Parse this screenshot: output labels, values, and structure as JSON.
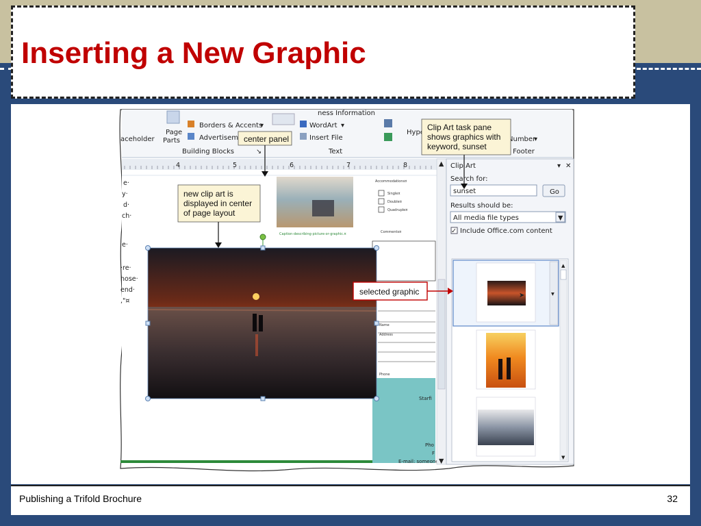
{
  "slide": {
    "title": "Inserting a New Graphic",
    "footer_left": "Publishing a Trifold Brochure",
    "page_number": "32"
  },
  "ribbon": {
    "placeholder_label": "aceholder",
    "page_parts_label": "Page",
    "page_parts_label2": "Parts",
    "borders_accents": "Borders & Accents",
    "advertisements": "Advertiseme",
    "building_blocks": "Building Blocks",
    "business_information": "ness Information",
    "wordart": "WordArt",
    "insert_file": "Insert File",
    "text_group": "Text",
    "hyperlink_partial": "Hype",
    "number_label": "Number",
    "header_footer_partial": "t Footer"
  },
  "ruler": {
    "marks": [
      "4",
      "5",
      "6",
      "7",
      "8"
    ]
  },
  "document": {
    "left_fragments": [
      "e·",
      "y·",
      "d·",
      "ch·",
      "e·",
      "·re·",
      "hose·",
      "end·",
      ",\"¤"
    ],
    "caption": "Caption·describing·picture·or·graphic.¤",
    "form_heading": "Accommodations¤",
    "options": [
      "Single¤",
      "Double¤",
      "Quadruple¤"
    ],
    "comments": "Comments¤",
    "field_labels": [
      "Name",
      "Address",
      "Phone"
    ],
    "starfish_text": "Starfi",
    "pho_text": "Pho",
    "f_text": "F",
    "email_text": "E-mail: someone"
  },
  "clip_art_pane": {
    "title": "Clip Art",
    "search_label": "Search for:",
    "search_value": "sunset",
    "go_button": "Go",
    "results_label": "Results should be:",
    "media_types": "All media file types",
    "include_office": "Include Office.com content"
  },
  "callouts": {
    "center_panel": "center panel",
    "clip_art_pane": [
      "Clip Art task pane",
      "shows graphics with",
      "keyword, sunset"
    ],
    "new_clip_art": [
      "new clip art is",
      "displayed in center",
      "of page layout"
    ],
    "selected_graphic": "selected graphic"
  },
  "colors": {
    "title_red": "#c00000",
    "background_blue": "#2a4a7a",
    "band_tan": "#c8c1a0",
    "callout_fill": "#fbf4d6",
    "callout_red": "#c00000",
    "teal_panel": "#7ac5c5"
  }
}
